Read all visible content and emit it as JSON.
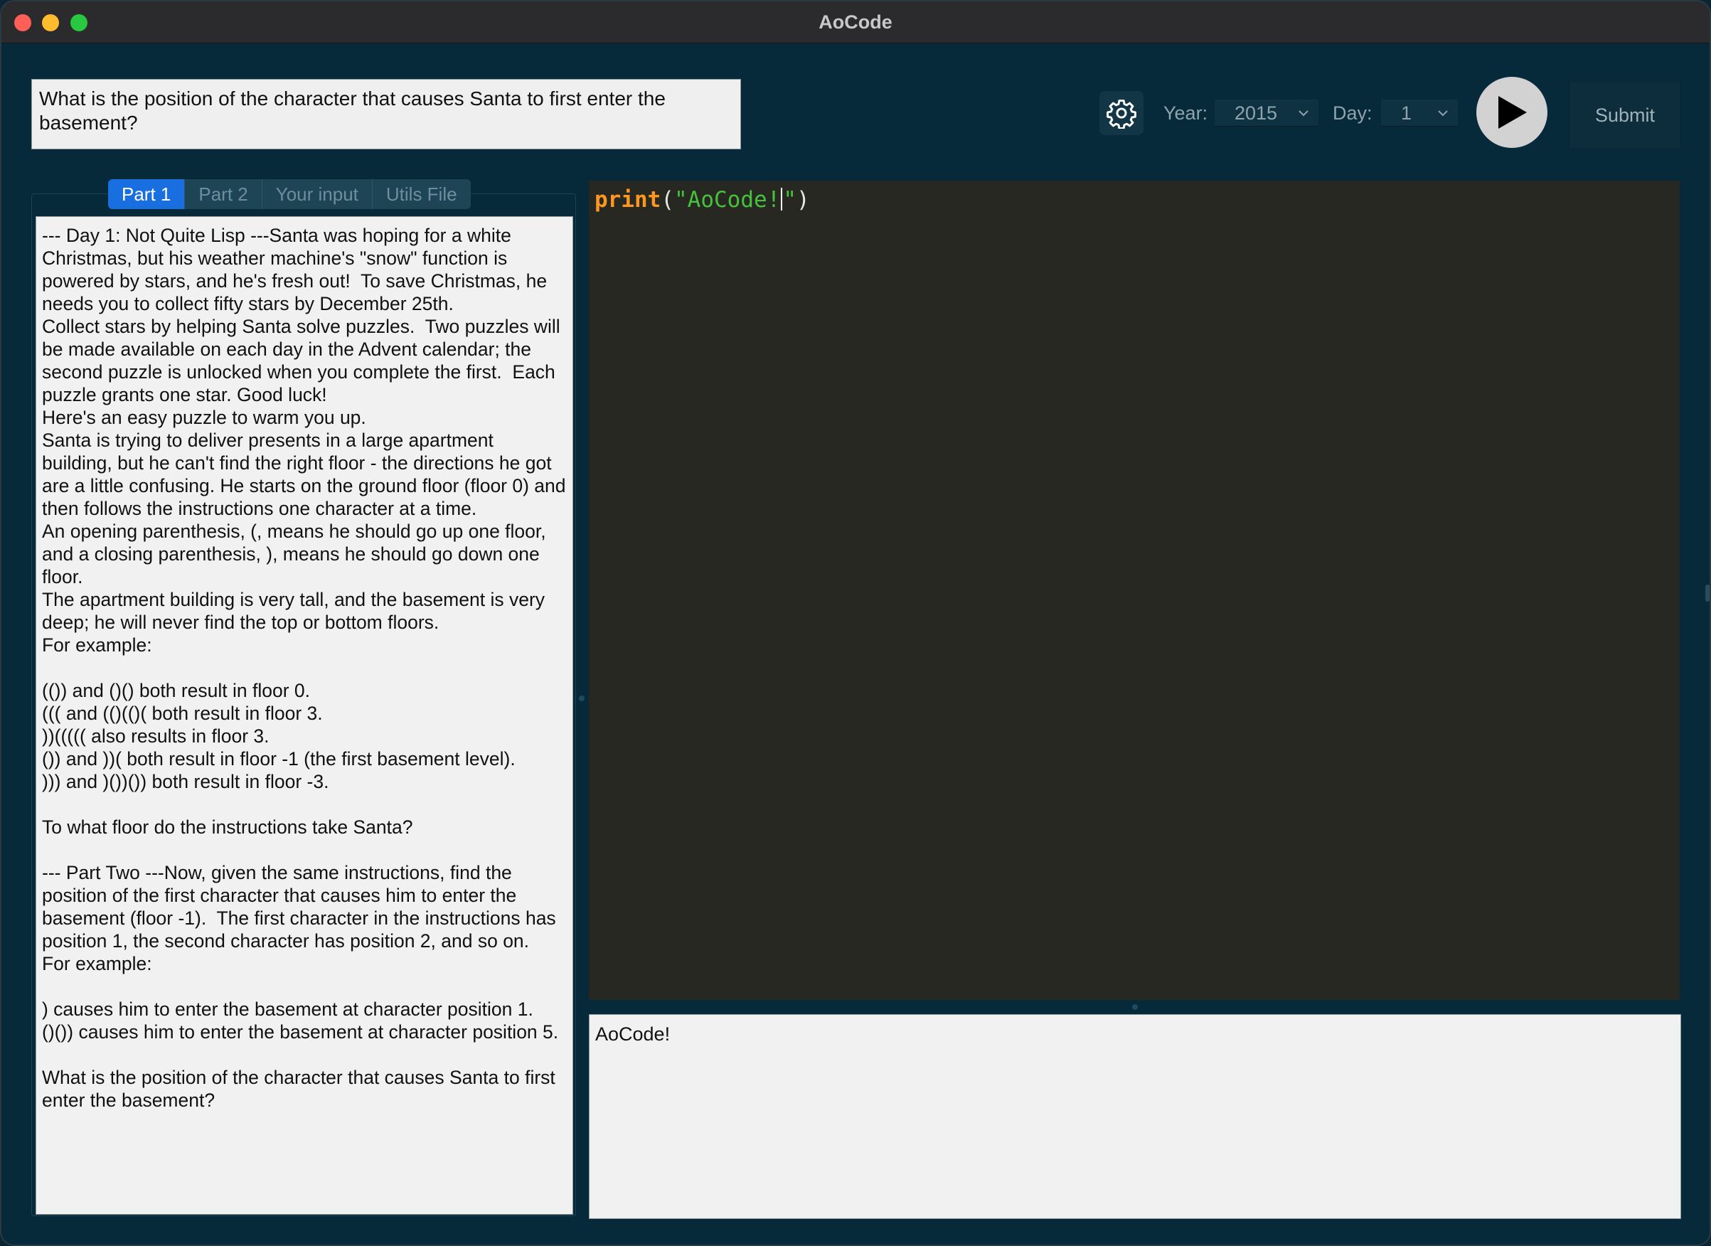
{
  "window": {
    "title": "AoCode"
  },
  "question": "What is the position of the character that causes Santa to first enter the basement?",
  "toolbar": {
    "year_label": "Year:",
    "year_value": "2015",
    "day_label": "Day:",
    "day_value": "1",
    "submit_label": "Submit"
  },
  "tabs": [
    {
      "label": "Part 1",
      "active": true
    },
    {
      "label": "Part 2",
      "active": false
    },
    {
      "label": "Your input",
      "active": false
    },
    {
      "label": "Utils File",
      "active": false
    }
  ],
  "description": "--- Day 1: Not Quite Lisp ---Santa was hoping for a white Christmas, but his weather machine's \"snow\" function is powered by stars, and he's fresh out!  To save Christmas, he needs you to collect fifty stars by December 25th.\nCollect stars by helping Santa solve puzzles.  Two puzzles will be made available on each day in the Advent calendar; the second puzzle is unlocked when you complete the first.  Each puzzle grants one star. Good luck!\nHere's an easy puzzle to warm you up.\nSanta is trying to deliver presents in a large apartment building, but he can't find the right floor - the directions he got are a little confusing. He starts on the ground floor (floor 0) and then follows the instructions one character at a time.\nAn opening parenthesis, (, means he should go up one floor, and a closing parenthesis, ), means he should go down one floor.\nThe apartment building is very tall, and the basement is very deep; he will never find the top or bottom floors.\nFor example:\n\n(()) and ()() both result in floor 0.\n((( and (()(()( both result in floor 3.\n))((((( also results in floor 3.\n()) and ))( both result in floor -1 (the first basement level).\n))) and )())()) both result in floor -3.\n\nTo what floor do the instructions take Santa?\n\n--- Part Two ---Now, given the same instructions, find the position of the first character that causes him to enter the basement (floor -1).  The first character in the instructions has position 1, the second character has position 2, and so on.\nFor example:\n\n) causes him to enter the basement at character position 1.\n()()) causes him to enter the basement at character position 5.\n\nWhat is the position of the character that causes Santa to first enter the basement?",
  "editor": {
    "fn": "print",
    "open": "(",
    "string_before_caret": "\"AoCode!",
    "string_after_caret": "\"",
    "close": ")"
  },
  "output": "AoCode!",
  "colors": {
    "background": "#072a3a",
    "accent_tab": "#1a6fe0",
    "editor_bg": "#272822",
    "code_function": "#fd971f",
    "code_string": "#46c23b"
  },
  "icons": {
    "settings": "gear-icon",
    "run": "play-icon",
    "dropdown": "chevron-down-icon"
  }
}
